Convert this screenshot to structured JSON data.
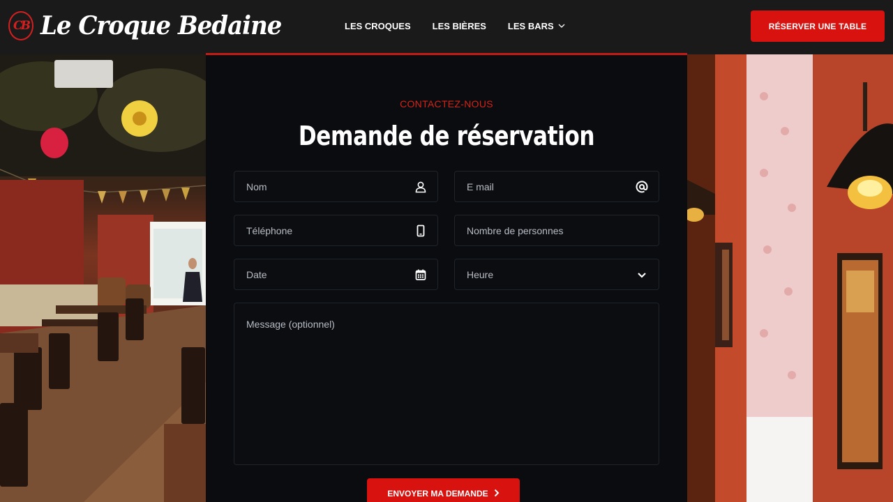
{
  "brand": {
    "mark": "CB",
    "name": "Le Croque Bedaine",
    "accent_color": "#d8120f"
  },
  "nav": {
    "items": [
      {
        "label": "LES CROQUES"
      },
      {
        "label": "LES BIÈRES"
      },
      {
        "label": "LES BARS",
        "icon": "chevron-down-icon"
      }
    ],
    "cta_label": "RÉSERVER UNE TABLE"
  },
  "form": {
    "eyebrow": "CONTACTEZ-NOUS",
    "title": "Demande de réservation",
    "fields": {
      "name": {
        "placeholder": "Nom",
        "icon": "user-icon"
      },
      "email": {
        "placeholder": "E mail",
        "icon": "at-icon"
      },
      "phone": {
        "placeholder": "Téléphone",
        "icon": "phone-icon"
      },
      "guests": {
        "placeholder": "Nombre de personnes"
      },
      "date": {
        "placeholder": "Date",
        "icon": "calendar-icon"
      },
      "time": {
        "placeholder": "Heure",
        "icon": "chevron-down-icon"
      },
      "message": {
        "placeholder": "Message (optionnel)"
      }
    },
    "submit_label": "ENVOYER MA DEMANDE"
  }
}
